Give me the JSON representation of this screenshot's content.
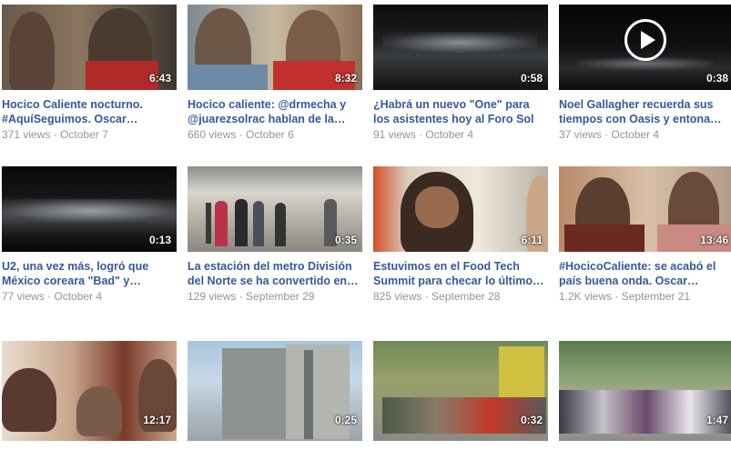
{
  "videos": [
    {
      "title": "Hocico Caliente nocturno. #AquíSeguimos. Oscar…",
      "duration": "6:43",
      "views": "371 views",
      "date": "October 7"
    },
    {
      "title": "Hocico caliente: @drmecha y @juarezsolrac hablan de la…",
      "duration": "8:32",
      "views": "660 views",
      "date": "October 6"
    },
    {
      "title": "¿Habrá un nuevo \"One\" para los asistentes hoy al Foro Sol para…",
      "duration": "0:58",
      "views": "91 views",
      "date": "October 4"
    },
    {
      "title": "Noel Gallagher recuerda sus tiempos con Oasis y entona…",
      "duration": "0:38",
      "views": "37 views",
      "date": "October 4"
    },
    {
      "title": "U2, una vez más, logró que México coreara \"Bad\" y…",
      "duration": "0:13",
      "views": "77 views",
      "date": "October 4"
    },
    {
      "title": "La estación del metro División del Norte se ha convertido en…",
      "duration": "0:35",
      "views": "129 views",
      "date": "September 29"
    },
    {
      "title": "Estuvimos en el Food Tech Summit para checar lo último…",
      "duration": "6:11",
      "views": "825 views",
      "date": "September 28"
    },
    {
      "title": "#HocicoCaliente: se acabó el país buena onda. Oscar…",
      "duration": "13:46",
      "views": "1.2K views",
      "date": "September 21"
    },
    {
      "title": "",
      "duration": "12:17",
      "views": "",
      "date": ""
    },
    {
      "title": "",
      "duration": "0:25",
      "views": "",
      "date": ""
    },
    {
      "title": "",
      "duration": "0:32",
      "views": "",
      "date": ""
    },
    {
      "title": "",
      "duration": "1:47",
      "views": "",
      "date": ""
    }
  ],
  "separator": " · ",
  "icons": {
    "play": "play-circle-icon"
  }
}
